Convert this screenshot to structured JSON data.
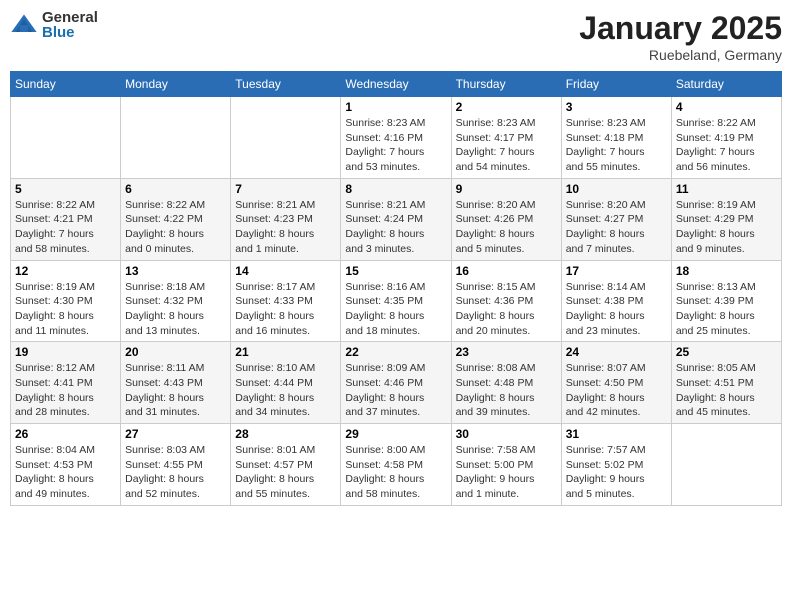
{
  "logo": {
    "general": "General",
    "blue": "Blue"
  },
  "header": {
    "month": "January 2025",
    "location": "Ruebeland, Germany"
  },
  "weekdays": [
    "Sunday",
    "Monday",
    "Tuesday",
    "Wednesday",
    "Thursday",
    "Friday",
    "Saturday"
  ],
  "weeks": [
    [
      {
        "day": "",
        "info": ""
      },
      {
        "day": "",
        "info": ""
      },
      {
        "day": "",
        "info": ""
      },
      {
        "day": "1",
        "info": "Sunrise: 8:23 AM\nSunset: 4:16 PM\nDaylight: 7 hours\nand 53 minutes."
      },
      {
        "day": "2",
        "info": "Sunrise: 8:23 AM\nSunset: 4:17 PM\nDaylight: 7 hours\nand 54 minutes."
      },
      {
        "day": "3",
        "info": "Sunrise: 8:23 AM\nSunset: 4:18 PM\nDaylight: 7 hours\nand 55 minutes."
      },
      {
        "day": "4",
        "info": "Sunrise: 8:22 AM\nSunset: 4:19 PM\nDaylight: 7 hours\nand 56 minutes."
      }
    ],
    [
      {
        "day": "5",
        "info": "Sunrise: 8:22 AM\nSunset: 4:21 PM\nDaylight: 7 hours\nand 58 minutes."
      },
      {
        "day": "6",
        "info": "Sunrise: 8:22 AM\nSunset: 4:22 PM\nDaylight: 8 hours\nand 0 minutes."
      },
      {
        "day": "7",
        "info": "Sunrise: 8:21 AM\nSunset: 4:23 PM\nDaylight: 8 hours\nand 1 minute."
      },
      {
        "day": "8",
        "info": "Sunrise: 8:21 AM\nSunset: 4:24 PM\nDaylight: 8 hours\nand 3 minutes."
      },
      {
        "day": "9",
        "info": "Sunrise: 8:20 AM\nSunset: 4:26 PM\nDaylight: 8 hours\nand 5 minutes."
      },
      {
        "day": "10",
        "info": "Sunrise: 8:20 AM\nSunset: 4:27 PM\nDaylight: 8 hours\nand 7 minutes."
      },
      {
        "day": "11",
        "info": "Sunrise: 8:19 AM\nSunset: 4:29 PM\nDaylight: 8 hours\nand 9 minutes."
      }
    ],
    [
      {
        "day": "12",
        "info": "Sunrise: 8:19 AM\nSunset: 4:30 PM\nDaylight: 8 hours\nand 11 minutes."
      },
      {
        "day": "13",
        "info": "Sunrise: 8:18 AM\nSunset: 4:32 PM\nDaylight: 8 hours\nand 13 minutes."
      },
      {
        "day": "14",
        "info": "Sunrise: 8:17 AM\nSunset: 4:33 PM\nDaylight: 8 hours\nand 16 minutes."
      },
      {
        "day": "15",
        "info": "Sunrise: 8:16 AM\nSunset: 4:35 PM\nDaylight: 8 hours\nand 18 minutes."
      },
      {
        "day": "16",
        "info": "Sunrise: 8:15 AM\nSunset: 4:36 PM\nDaylight: 8 hours\nand 20 minutes."
      },
      {
        "day": "17",
        "info": "Sunrise: 8:14 AM\nSunset: 4:38 PM\nDaylight: 8 hours\nand 23 minutes."
      },
      {
        "day": "18",
        "info": "Sunrise: 8:13 AM\nSunset: 4:39 PM\nDaylight: 8 hours\nand 25 minutes."
      }
    ],
    [
      {
        "day": "19",
        "info": "Sunrise: 8:12 AM\nSunset: 4:41 PM\nDaylight: 8 hours\nand 28 minutes."
      },
      {
        "day": "20",
        "info": "Sunrise: 8:11 AM\nSunset: 4:43 PM\nDaylight: 8 hours\nand 31 minutes."
      },
      {
        "day": "21",
        "info": "Sunrise: 8:10 AM\nSunset: 4:44 PM\nDaylight: 8 hours\nand 34 minutes."
      },
      {
        "day": "22",
        "info": "Sunrise: 8:09 AM\nSunset: 4:46 PM\nDaylight: 8 hours\nand 37 minutes."
      },
      {
        "day": "23",
        "info": "Sunrise: 8:08 AM\nSunset: 4:48 PM\nDaylight: 8 hours\nand 39 minutes."
      },
      {
        "day": "24",
        "info": "Sunrise: 8:07 AM\nSunset: 4:50 PM\nDaylight: 8 hours\nand 42 minutes."
      },
      {
        "day": "25",
        "info": "Sunrise: 8:05 AM\nSunset: 4:51 PM\nDaylight: 8 hours\nand 45 minutes."
      }
    ],
    [
      {
        "day": "26",
        "info": "Sunrise: 8:04 AM\nSunset: 4:53 PM\nDaylight: 8 hours\nand 49 minutes."
      },
      {
        "day": "27",
        "info": "Sunrise: 8:03 AM\nSunset: 4:55 PM\nDaylight: 8 hours\nand 52 minutes."
      },
      {
        "day": "28",
        "info": "Sunrise: 8:01 AM\nSunset: 4:57 PM\nDaylight: 8 hours\nand 55 minutes."
      },
      {
        "day": "29",
        "info": "Sunrise: 8:00 AM\nSunset: 4:58 PM\nDaylight: 8 hours\nand 58 minutes."
      },
      {
        "day": "30",
        "info": "Sunrise: 7:58 AM\nSunset: 5:00 PM\nDaylight: 9 hours\nand 1 minute."
      },
      {
        "day": "31",
        "info": "Sunrise: 7:57 AM\nSunset: 5:02 PM\nDaylight: 9 hours\nand 5 minutes."
      },
      {
        "day": "",
        "info": ""
      }
    ]
  ]
}
